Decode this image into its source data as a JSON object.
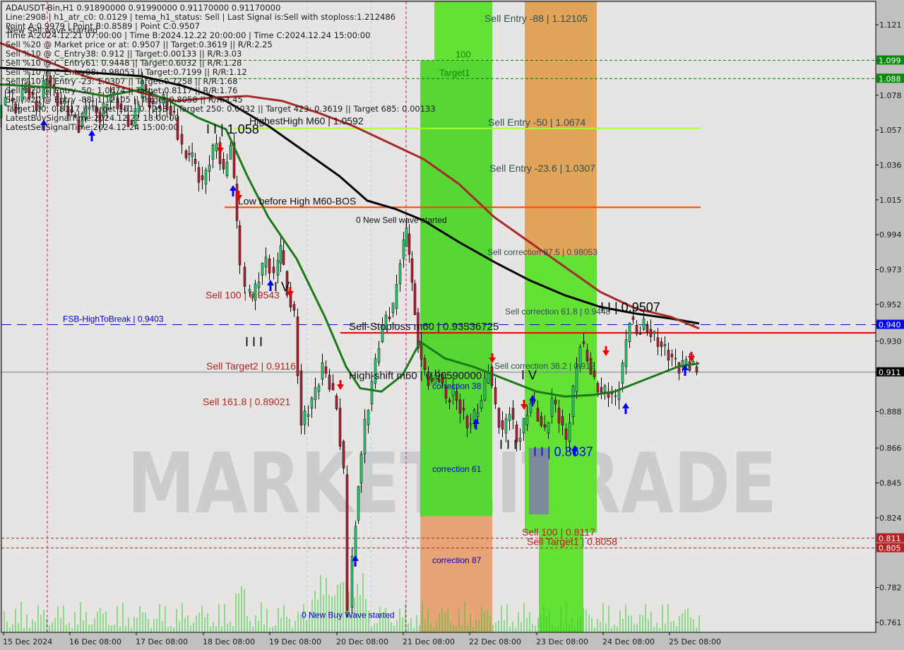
{
  "header": {
    "symbol_line": "ADAUSDT-Bin,H1  0.91890000 0.91990000 0.91170000 0.91170000",
    "info_lines": [
      "Line:2908 | h1_atr_c0: 0.0129 | tema_h1_status: Sell | Last Signal is:Sell with stoploss:1.212486",
      "Point A:0.9979 | Point B:0.8589 | Point C:0.9507",
      "Time A:2024.12.21 07:00:00 | Time B:2024.12.22 20:00:00 | Time C:2024.12.24 15:00:00",
      "Sell %20 @ Market price or at: 0.9507 || Target:0.3619 || R/R:2.25",
      "Sell %10 @ C_Entry38: 0.912 || Target:0.00133 || R/R:3.03",
      "Sell %10 @ C_Entry61: 0.9448 || Target:0.6032 || R/R:1.28",
      "Sell %10 @ C_Entry88: 0.98053 || Target:0.7199 || R/R:1.12",
      "Sell %10 @ Entry -23: 1.0307 || Target:0.7258 || R/R:1.68",
      "Sell %20 @ Entry -50: 1.0674 || Target:0.8117 || R/R:1.76",
      "Sell %20 @ Entry -88: 1.12105 || Target:0.8058 || R/R:3.45",
      "Target100: 0.8117 || Target 161: 0.7258 || Target 250: 0.6032 || Target 423: 0.3619 || Target 685: 0.00133",
      "LatestBuySignalTime:2024.12.21 18:00:00",
      "LatestSellSignalTime:2024.12.24 15:00:00"
    ],
    "overlay_text": "New Sell wave started"
  },
  "watermark": "MARKETZITRADE",
  "chart_data": {
    "type": "candlestick",
    "title": "ADAUSDT-Bin,H1",
    "ohlc_last": {
      "open": 0.9189,
      "high": 0.9199,
      "low": 0.9117,
      "close": 0.9117
    },
    "ylim": [
      0.755,
      1.135
    ],
    "y_ticks": [
      "1.121",
      "1.099",
      "1.088",
      "1.078",
      "1.057",
      "1.036",
      "1.015",
      "0.994",
      "0.973",
      "0.952",
      "0.940",
      "0.930",
      "0.911",
      "0.888",
      "0.866",
      "0.845",
      "0.824",
      "0.811",
      "0.805",
      "0.782",
      "0.761"
    ],
    "y_tick_values": [
      1.121,
      1.0995,
      1.0885,
      1.0785,
      1.0575,
      1.0365,
      1.0155,
      0.9945,
      0.9735,
      0.9525,
      0.9403,
      0.9304,
      0.9117,
      0.888,
      0.866,
      0.845,
      0.824,
      0.8117,
      0.8058,
      0.782,
      0.761
    ],
    "price_tags": [
      {
        "label": "1.099",
        "value": 1.0995,
        "color": "#0a8a0a"
      },
      {
        "label": "1.088",
        "value": 1.0885,
        "color": "#0a8a0a"
      },
      {
        "label": "0.940",
        "value": 0.9403,
        "color": "#0000ff"
      },
      {
        "label": "0.911",
        "value": 0.9117,
        "color": "#000000"
      },
      {
        "label": "0.811",
        "value": 0.8117,
        "color": "#b22222"
      },
      {
        "label": "0.805",
        "value": 0.8058,
        "color": "#b22222"
      }
    ],
    "x_ticks": [
      "15 Dec 2024",
      "16 Dec 08:00",
      "17 Dec 08:00",
      "18 Dec 08:00",
      "19 Dec 08:00",
      "20 Dec 08:00",
      "21 Dec 08:00",
      "22 Dec 08:00",
      "23 Dec 08:00",
      "24 Dec 08:00",
      "25 Dec 08:00"
    ],
    "close_path": [
      [
        0,
        1.065
      ],
      [
        12,
        1.08
      ],
      [
        25,
        1.07
      ],
      [
        40,
        1.085
      ],
      [
        55,
        1.07
      ],
      [
        70,
        1.09
      ],
      [
        85,
        1.075
      ],
      [
        100,
        1.07
      ],
      [
        115,
        1.06
      ],
      [
        130,
        1.075
      ],
      [
        145,
        1.065
      ],
      [
        160,
        1.08
      ],
      [
        175,
        1.07
      ],
      [
        190,
        1.06
      ],
      [
        205,
        1.085
      ],
      [
        220,
        1.07
      ],
      [
        235,
        1.075
      ],
      [
        250,
        1.065
      ],
      [
        262,
        1.045
      ],
      [
        275,
        1.04
      ],
      [
        290,
        1.025
      ],
      [
        300,
        1.04
      ],
      [
        310,
        1.05
      ],
      [
        320,
        1.03
      ],
      [
        330,
        1.05
      ],
      [
        338,
        1.0
      ],
      [
        345,
        0.975
      ],
      [
        352,
        0.96
      ],
      [
        360,
        0.955
      ],
      [
        370,
        0.97
      ],
      [
        380,
        0.98
      ],
      [
        392,
        0.97
      ],
      [
        400,
        0.985
      ],
      [
        410,
        0.96
      ],
      [
        420,
        0.945
      ],
      [
        430,
        0.88
      ],
      [
        440,
        0.89
      ],
      [
        450,
        0.9
      ],
      [
        460,
        0.915
      ],
      [
        470,
        0.905
      ],
      [
        480,
        0.89
      ],
      [
        490,
        0.85
      ],
      [
        497,
        0.77
      ],
      [
        502,
        0.8
      ],
      [
        510,
        0.845
      ],
      [
        520,
        0.88
      ],
      [
        530,
        0.905
      ],
      [
        540,
        0.93
      ],
      [
        550,
        0.945
      ],
      [
        560,
        0.95
      ],
      [
        570,
        0.98
      ],
      [
        578,
        0.995
      ],
      [
        586,
        0.965
      ],
      [
        595,
        0.93
      ],
      [
        605,
        0.91
      ],
      [
        615,
        0.905
      ],
      [
        625,
        0.91
      ],
      [
        635,
        0.895
      ],
      [
        645,
        0.9
      ],
      [
        655,
        0.89
      ],
      [
        665,
        0.88
      ],
      [
        675,
        0.885
      ],
      [
        685,
        0.895
      ],
      [
        695,
        0.915
      ],
      [
        705,
        0.89
      ],
      [
        715,
        0.875
      ],
      [
        725,
        0.89
      ],
      [
        735,
        0.87
      ],
      [
        745,
        0.88
      ],
      [
        755,
        0.895
      ],
      [
        765,
        0.885
      ],
      [
        775,
        0.875
      ],
      [
        785,
        0.895
      ],
      [
        795,
        0.885
      ],
      [
        805,
        0.87
      ],
      [
        815,
        0.9
      ],
      [
        825,
        0.93
      ],
      [
        835,
        0.92
      ],
      [
        845,
        0.905
      ],
      [
        855,
        0.9
      ],
      [
        865,
        0.9
      ],
      [
        875,
        0.895
      ],
      [
        885,
        0.915
      ],
      [
        895,
        0.945
      ],
      [
        905,
        0.935
      ],
      [
        915,
        0.94
      ],
      [
        925,
        0.935
      ],
      [
        935,
        0.93
      ],
      [
        945,
        0.925
      ],
      [
        955,
        0.92
      ],
      [
        965,
        0.915
      ],
      [
        975,
        0.918
      ],
      [
        985,
        0.915
      ],
      [
        992,
        0.9117
      ]
    ],
    "series": [
      {
        "name": "moving-average-black",
        "color": "#000000",
        "points": [
          [
            0,
            1.095
          ],
          [
            100,
            1.093
          ],
          [
            200,
            1.09
          ],
          [
            260,
            1.084
          ],
          [
            320,
            1.075
          ],
          [
            380,
            1.06
          ],
          [
            430,
            1.045
          ],
          [
            480,
            1.03
          ],
          [
            520,
            1.015
          ],
          [
            560,
            1.01
          ],
          [
            600,
            1.003
          ],
          [
            650,
            0.99
          ],
          [
            700,
            0.978
          ],
          [
            750,
            0.967
          ],
          [
            800,
            0.958
          ],
          [
            850,
            0.951
          ],
          [
            900,
            0.947
          ],
          [
            950,
            0.944
          ],
          [
            990,
            0.941
          ]
        ]
      },
      {
        "name": "moving-average-darkred",
        "color": "#a52a2a",
        "points": [
          [
            0,
            1.11
          ],
          [
            60,
            1.1
          ],
          [
            120,
            1.09
          ],
          [
            200,
            1.08
          ],
          [
            250,
            1.075
          ],
          [
            300,
            1.077
          ],
          [
            350,
            1.078
          ],
          [
            400,
            1.075
          ],
          [
            450,
            1.068
          ],
          [
            500,
            1.06
          ],
          [
            550,
            1.05
          ],
          [
            600,
            1.04
          ],
          [
            650,
            1.025
          ],
          [
            700,
            1.005
          ],
          [
            750,
            0.99
          ],
          [
            800,
            0.975
          ],
          [
            850,
            0.96
          ],
          [
            900,
            0.95
          ],
          [
            950,
            0.945
          ],
          [
            990,
            0.938
          ]
        ]
      },
      {
        "name": "moving-average-green",
        "color": "#1a7a1a",
        "points": [
          [
            0,
            1.085
          ],
          [
            80,
            1.083
          ],
          [
            150,
            1.078
          ],
          [
            200,
            1.082
          ],
          [
            240,
            1.075
          ],
          [
            280,
            1.065
          ],
          [
            320,
            1.058
          ],
          [
            350,
            1.03
          ],
          [
            380,
            1.005
          ],
          [
            420,
            0.98
          ],
          [
            460,
            0.945
          ],
          [
            490,
            0.915
          ],
          [
            510,
            0.902
          ],
          [
            540,
            0.9
          ],
          [
            570,
            0.91
          ],
          [
            595,
            0.93
          ],
          [
            630,
            0.92
          ],
          [
            670,
            0.915
          ],
          [
            700,
            0.91
          ],
          [
            730,
            0.905
          ],
          [
            760,
            0.9
          ],
          [
            800,
            0.897
          ],
          [
            840,
            0.898
          ],
          [
            870,
            0.9
          ],
          [
            900,
            0.905
          ],
          [
            930,
            0.91
          ],
          [
            960,
            0.915
          ],
          [
            990,
            0.917
          ]
        ]
      }
    ],
    "horizontal_levels": [
      {
        "label": "Sell Entry -88 | 1.12105",
        "value": 1.12105,
        "color": "#2f4f4f",
        "line": false
      },
      {
        "label": "100",
        "value": 1.0995,
        "color": "#0a8a0a",
        "line": "dashed-green"
      },
      {
        "label": "Target1",
        "value": 1.0885,
        "color": "#0a8a0a",
        "line": "dashed-green"
      },
      {
        "label": "HighestHigh   M60 | 1.0592",
        "value": 1.0592,
        "color": "#111111",
        "line": false
      },
      {
        "label": "Sell Entry -50 | 1.0674",
        "value": 1.0585,
        "color": "#2f4f4f",
        "line": "solid-lime"
      },
      {
        "label": "Sell Entry -23.6 | 1.0307",
        "value": 1.0307,
        "color": "#2f4f4f",
        "line": false
      },
      {
        "label": "Low before High   M60-BOS",
        "value": 1.011,
        "color": "#111111",
        "line": "solid-orange"
      },
      {
        "label": "0 New Sell wave started",
        "value": 1.0,
        "color": "#111111",
        "line": false
      },
      {
        "label": "Sell correction 87.5 | 0.98053",
        "value": 0.98053,
        "color": "#2f4f4f",
        "line": false
      },
      {
        "label": "FSB-HighToBreak | 0.9403",
        "value": 0.9403,
        "color": "#0000cd",
        "line": "dashed-blue"
      },
      {
        "label": "Sell correction 61.8 | 0.9448",
        "value": 0.9448,
        "color": "#2f4f4f",
        "line": false
      },
      {
        "label": "Sell-Stoploss m60 | 0.93536725",
        "value": 0.93536725,
        "color": "#111111",
        "line": "solid-red"
      },
      {
        "label": "High-shift m60 | 0.90590000",
        "value": 0.9059,
        "color": "#111111",
        "line": false
      },
      {
        "label": "Sell correction 38.2 | 0.912",
        "value": 0.912,
        "color": "#2f4f4f",
        "line": false
      },
      {
        "label": "correction 38",
        "value": 0.9,
        "color": "#0000cd",
        "line": false
      },
      {
        "label": "correction 61",
        "value": 0.85,
        "color": "#0000cd",
        "line": false
      },
      {
        "label": "correction 87",
        "value": 0.795,
        "color": "#0000cd",
        "line": false
      },
      {
        "label": "Sell 100 | 0.9543",
        "value": 0.9543,
        "color": "#b22222",
        "line": false
      },
      {
        "label": "Sell Target2 | 0.9116",
        "value": 0.9116,
        "color": "#b22222",
        "line": false
      },
      {
        "label": "Sell 161.8 | 0.89021",
        "value": 0.89021,
        "color": "#b22222",
        "line": false
      },
      {
        "label": "Sell 100 | 0.8117",
        "value": 0.8117,
        "color": "#b22222",
        "line": "dashed-darkred"
      },
      {
        "label": "Sell Target1 | 0.8058",
        "value": 0.8058,
        "color": "#b22222",
        "line": "dashed-darkred"
      },
      {
        "label": "0 New Buy Wave started",
        "value": 0.762,
        "color": "#0000cd",
        "line": false
      }
    ],
    "wave_labels": [
      {
        "label": "I I | 1.058",
        "value": 1.058,
        "color": "#000000"
      },
      {
        "label": "I V",
        "value": 0.963,
        "color": "#000000"
      },
      {
        "label": "I I I",
        "value": 0.93,
        "color": "#000000"
      },
      {
        "label": "I I | 0.9507",
        "value": 0.9507,
        "color": "#000000"
      },
      {
        "label": "I V",
        "value": 0.91,
        "color": "#000000"
      },
      {
        "label": "I I I",
        "value": 0.868,
        "color": "#000000"
      },
      {
        "label": "I I | 0.8637",
        "value": 0.8637,
        "color": "#0000ff"
      }
    ],
    "zones": [
      {
        "name": "green-zone-1",
        "from": 1.135,
        "to": 1.0995,
        "color": "#5ce02a"
      },
      {
        "name": "green-zone-2",
        "from": 1.0995,
        "to": 0.825,
        "color": "#4fd62a"
      },
      {
        "name": "orange-zone-1",
        "from": 0.825,
        "to": 0.755,
        "color": "#e8a070"
      },
      {
        "name": "orange-zone-2",
        "from": 1.135,
        "to": 0.982,
        "color": "#e0a050"
      },
      {
        "name": "green-zone-3",
        "from": 0.982,
        "to": 0.815,
        "color": "#5ce02a"
      },
      {
        "name": "green-zone-4",
        "from": 0.815,
        "to": 0.755,
        "color": "#5ce02a"
      }
    ]
  }
}
